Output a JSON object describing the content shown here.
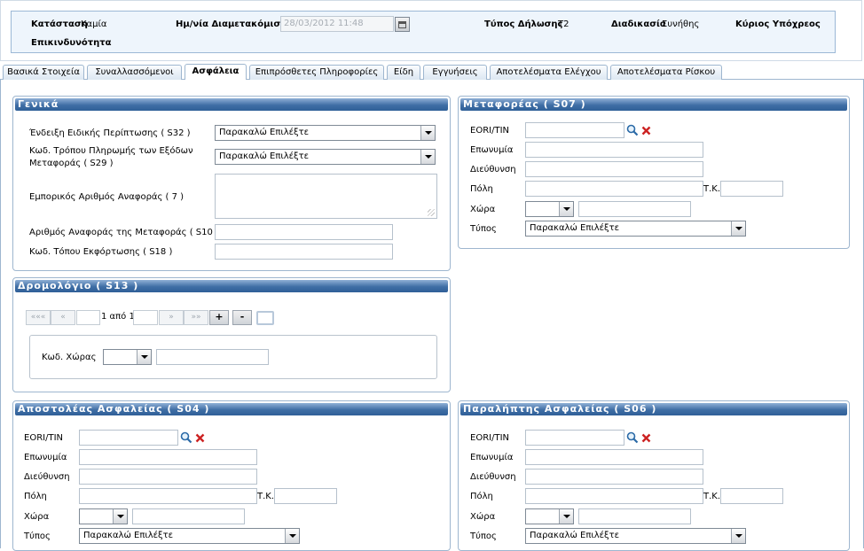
{
  "header": {
    "status_label": "Κατάσταση",
    "status_value": "Καμία",
    "danger_label": "Επικινδυνότητα",
    "datetime_label": "Ημ/νία Διαμετακόμισης",
    "datetime_value": "28/03/2012 11:48",
    "decl_type_label": "Τύπος Δήλωσης",
    "decl_type_value": "T2",
    "procedure_label": "Διαδικασία",
    "procedure_value": "Συνήθης",
    "principal_label": "Κύριος Υπόχρεος"
  },
  "tabs": [
    {
      "label": "Βασικά Στοιχεία"
    },
    {
      "label": "Συναλλασσόμενοι"
    },
    {
      "label": "Ασφάλεια"
    },
    {
      "label": "Επιπρόσθετες Πληροφορίες"
    },
    {
      "label": "Είδη"
    },
    {
      "label": "Εγγυήσεις"
    },
    {
      "label": "Αποτελέσματα Ελέγχου"
    },
    {
      "label": "Αποτελέσματα Ρίσκου"
    }
  ],
  "active_tab": "Ασφάλεια",
  "general": {
    "title": "Γενικά",
    "special_case_label": "Ένδειξη Ειδικής Περίπτωσης ( S32 )",
    "special_case_value": "Παρακαλώ Επιλέξτε",
    "payment_label_1": "Κωδ. Τρόπου Πληρωμής των Εξόδων",
    "payment_label_2": "Μεταφοράς ( S29 )",
    "payment_value": "Παρακαλώ Επιλέξτε",
    "commercial_ref_label": "Εμπορικός Αριθμός Αναφοράς ( 7 )",
    "transport_ref_label": "Αριθμός Αναφοράς της Μεταφοράς ( S10 )",
    "unloading_label": "Κωδ. Τόπου Εκφόρτωσης ( S18 )"
  },
  "itinerary": {
    "title": "Δρομολόγιο ( S13 )",
    "pager_first": "«««",
    "pager_prev": "«",
    "pager_text": "1 από 1",
    "pager_next": "»",
    "pager_last": "»»",
    "add_label": "+",
    "remove_label": "-",
    "country_code_label": "Κωδ. Χώρας"
  },
  "carrier": {
    "title": "Μεταφορέας ( S07 )",
    "eori_label": "EORI/TIN",
    "name_label": "Επωνυμία",
    "address_label": "Διεύθυνση",
    "city_label": "Πόλη",
    "postal_label": "Τ.Κ.",
    "country_label": "Χώρα",
    "type_label": "Τύπος",
    "type_value": "Παρακαλώ Επιλέξτε"
  },
  "consignor": {
    "title": "Αποστολέας Ασφαλείας ( S04 )",
    "eori_label": "EORI/TIN",
    "name_label": "Επωνυμία",
    "address_label": "Διεύθυνση",
    "city_label": "Πόλη",
    "postal_label": "Τ.Κ.",
    "country_label": "Χώρα",
    "type_label": "Τύπος",
    "type_value": "Παρακαλώ Επιλέξτε"
  },
  "consignee": {
    "title": "Παραλήπτης Ασφαλείας ( S06 )",
    "eori_label": "EORI/TIN",
    "name_label": "Επωνυμία",
    "address_label": "Διεύθυνση",
    "city_label": "Πόλη",
    "postal_label": "Τ.Κ.",
    "country_label": "Χώρα",
    "type_label": "Τύπος",
    "type_value": "Παρακαλώ Επιλέξτε"
  },
  "icons": {
    "search": "search-icon",
    "clear": "clear-icon",
    "calendar": "calendar-icon",
    "dropdown": "chevron-down-icon"
  },
  "colors": {
    "panel_title_bg": "#3f6ea5",
    "header_bg": "#eef5fc",
    "border": "#9eb6cf",
    "clear_icon": "#cc2222"
  }
}
